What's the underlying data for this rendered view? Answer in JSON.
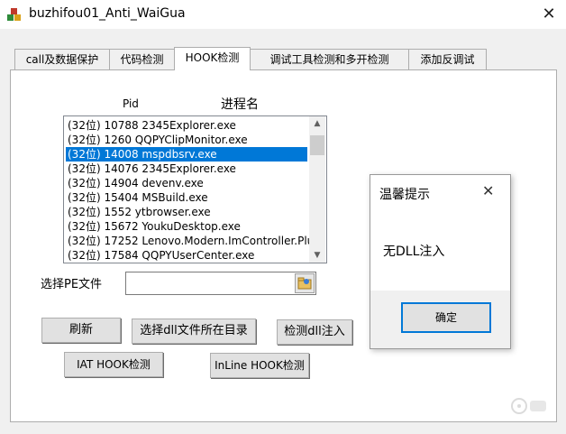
{
  "window": {
    "title": "buzhifou01_Anti_WaiGua",
    "close_glyph": "✕",
    "icon": "app-icon"
  },
  "tabs": [
    {
      "label": "call及数据保护",
      "active": false
    },
    {
      "label": "代码检测",
      "active": false
    },
    {
      "label": "HOOK检测",
      "active": true
    },
    {
      "label": "调试工具检测和多开检测",
      "active": false
    },
    {
      "label": "添加反调试",
      "active": false
    }
  ],
  "list": {
    "header_pid": "Pid",
    "header_name": "进程名",
    "items": [
      "(32位) 10788 2345Explorer.exe",
      "(32位) 1260 QQPYClipMonitor.exe",
      "(32位) 14008 mspdbsrv.exe",
      "(32位) 14076 2345Explorer.exe",
      "(32位) 14904 devenv.exe",
      "(32位) 15404 MSBuild.exe",
      "(32位) 1552 ytbrowser.exe",
      "(32位) 15672 YoukuDesktop.exe",
      "(32位) 17252 Lenovo.Modern.ImController.Plu",
      "(32位) 17584 QQPYUserCenter.exe"
    ],
    "selected_index": 2,
    "scroll_up": "▲",
    "scroll_down": "▼"
  },
  "pe_file": {
    "label": "选择PE文件",
    "value": "",
    "browse_icon": "folder-browse-icon"
  },
  "buttons": {
    "refresh": "刷新",
    "select_dll_dir": "选择dll文件所在目录",
    "detect_dll_injection": "检测dll注入",
    "iat_hook": "IAT HOOK检测",
    "inline_hook": "InLine HOOK检测"
  },
  "dialog": {
    "title": "温馨提示",
    "close_glyph": "✕",
    "message": "无DLL注入",
    "ok": "确定"
  },
  "colors": {
    "selection": "#0078d7",
    "window_bg": "#f0f0f0",
    "button_bg": "#e1e1e1"
  }
}
